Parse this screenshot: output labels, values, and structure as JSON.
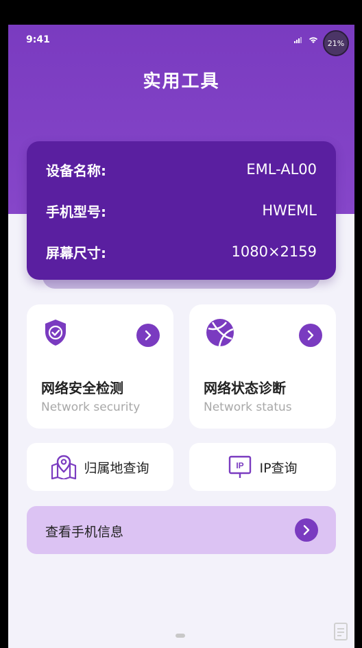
{
  "status_bar": {
    "time": "9:41",
    "battery_percent": "21%"
  },
  "page": {
    "title": "实用工具"
  },
  "device_info": {
    "rows": [
      {
        "label": "设备名称:",
        "value": "EML-AL00"
      },
      {
        "label": "手机型号:",
        "value": "HWEML"
      },
      {
        "label": "屏幕尺寸:",
        "value": "1080×2159"
      }
    ]
  },
  "tools": [
    {
      "title": "网络安全检测",
      "subtitle": "Network security",
      "icon": "shield-check-icon"
    },
    {
      "title": "网络状态诊断",
      "subtitle": "Network status",
      "icon": "globe-icon"
    }
  ],
  "quick_actions": [
    {
      "label": "归属地查询",
      "icon": "map-location-icon"
    },
    {
      "label": "IP查询",
      "icon": "ip-icon"
    }
  ],
  "phone_info": {
    "label": "查看手机信息"
  },
  "colors": {
    "primary": "#7a3bc0",
    "card_dark": "#5a1fa0",
    "light_purple": "#dcc3f3",
    "background": "#f3f2fa"
  }
}
